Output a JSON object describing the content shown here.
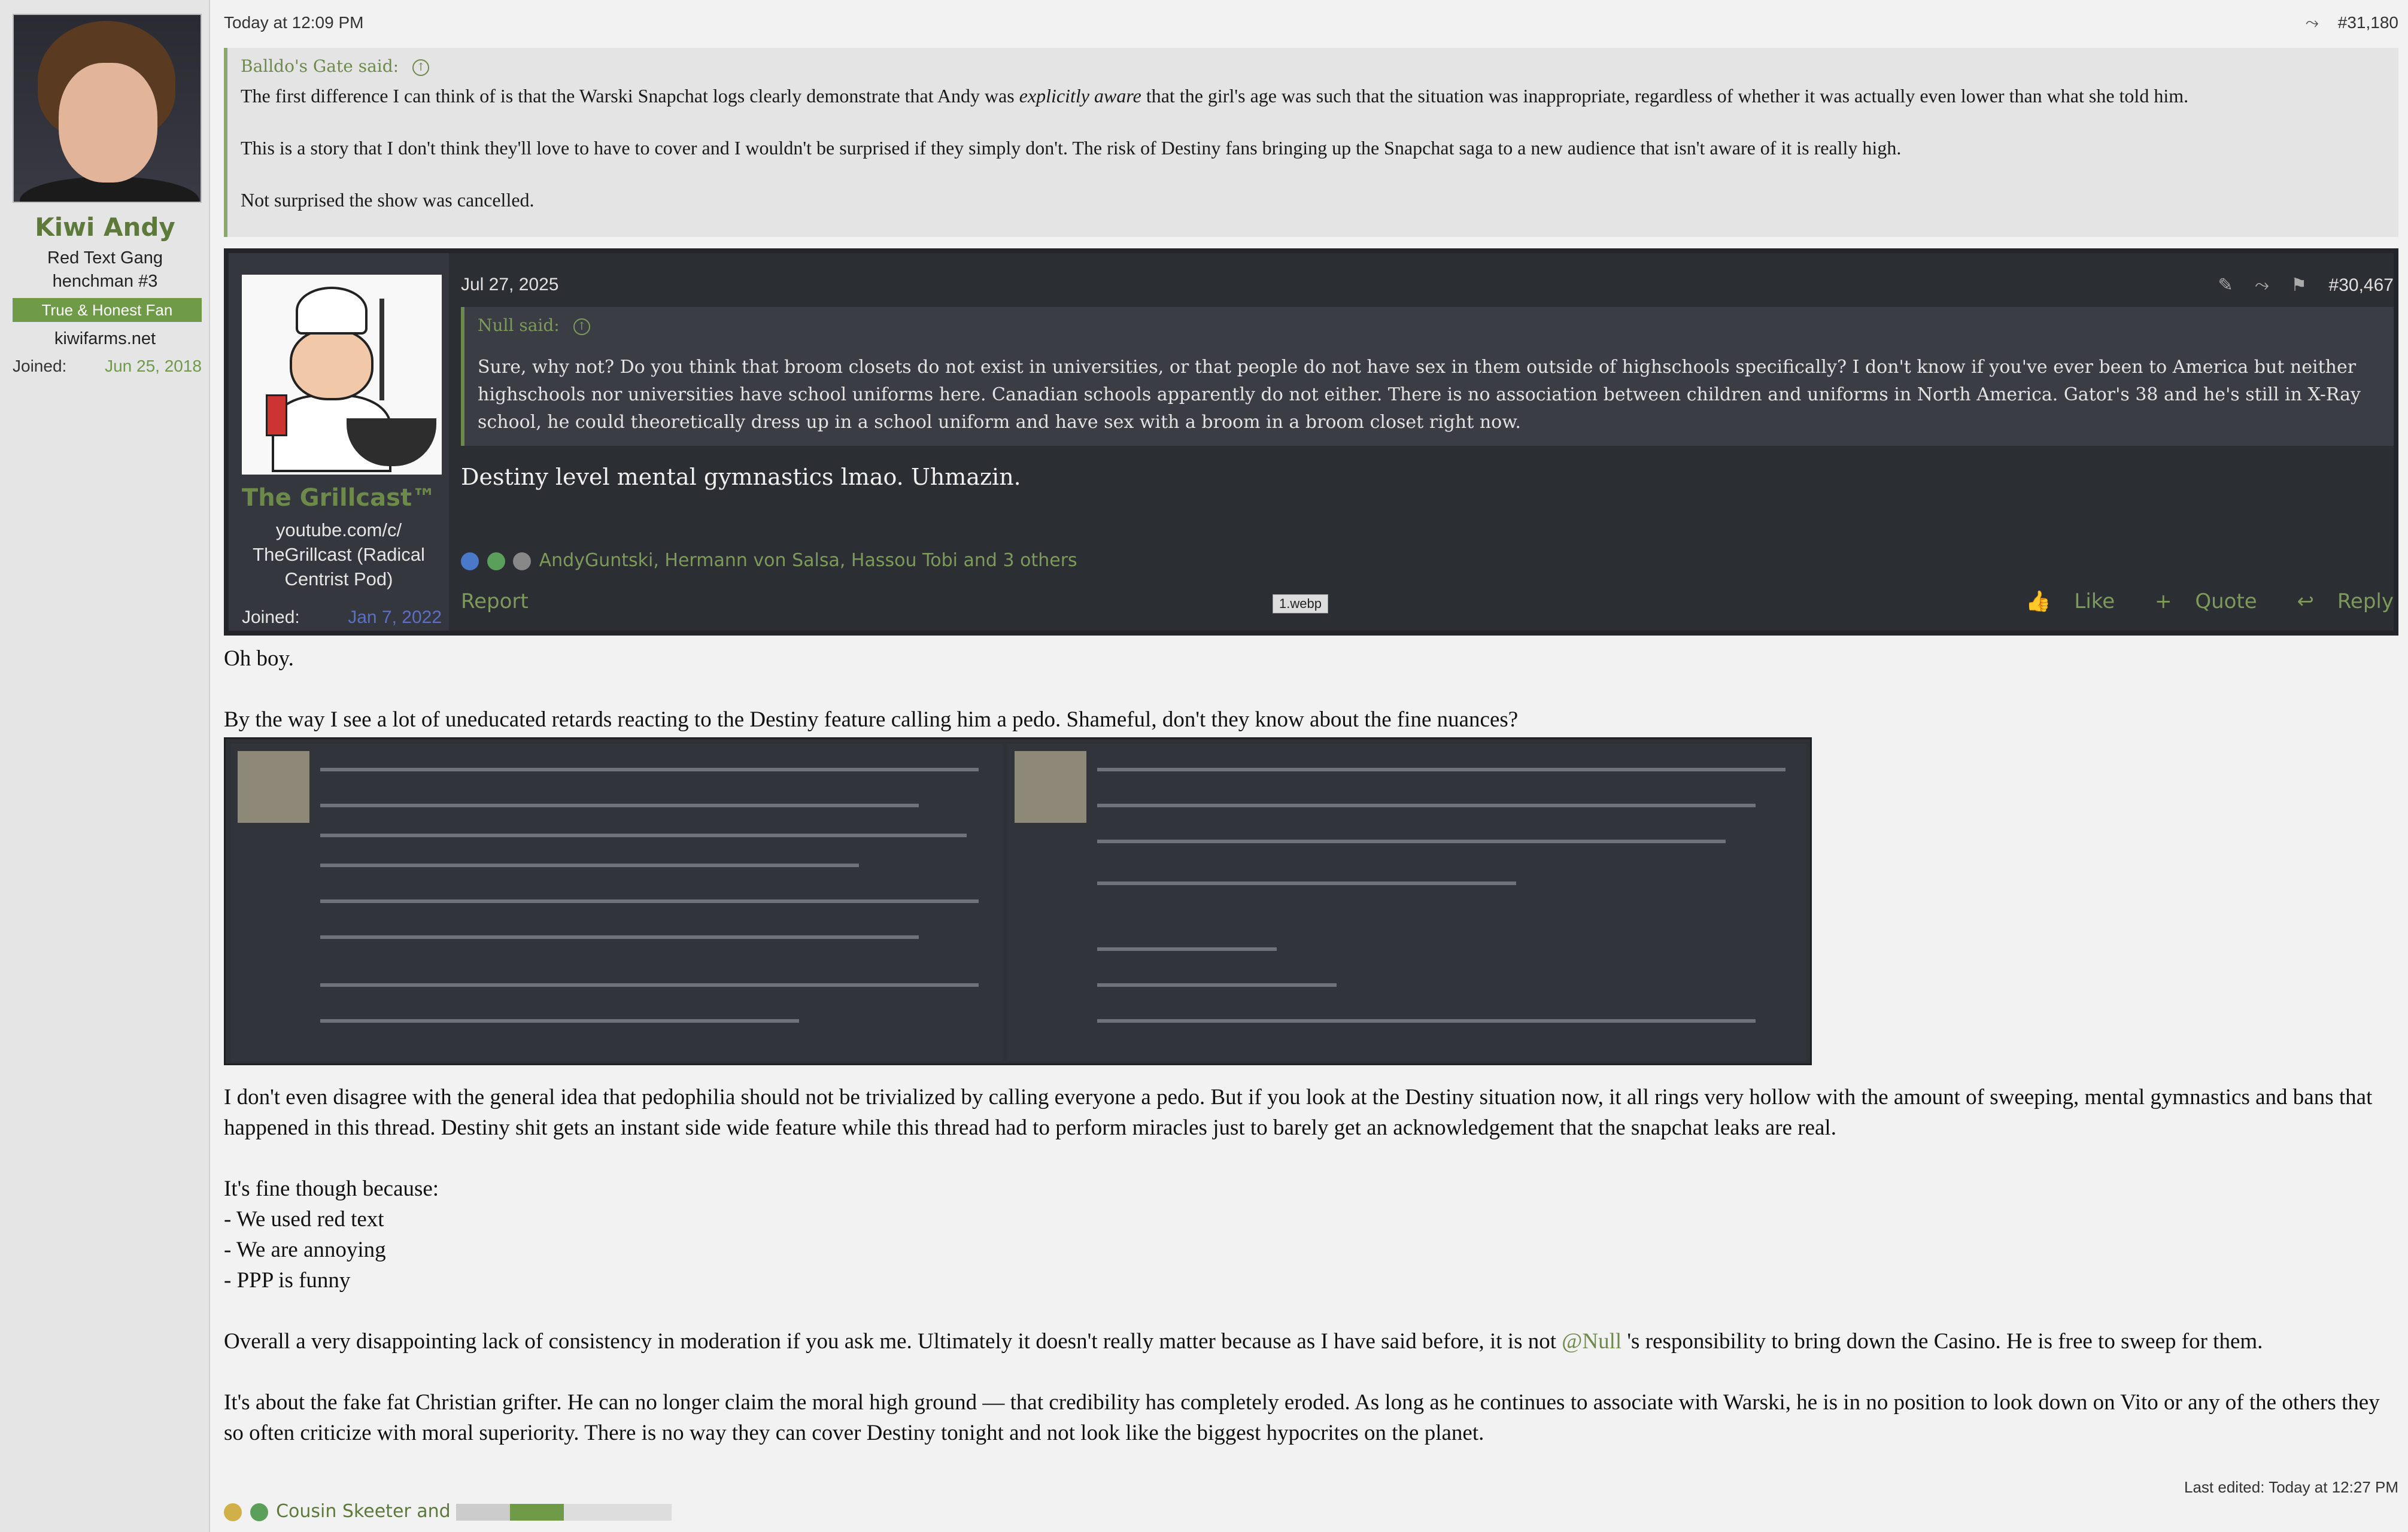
{
  "user": {
    "name": "Kiwi Andy",
    "title_line1": "Red Text Gang",
    "title_line2": "henchman #3",
    "banner": "True & Honest Fan",
    "site": "kiwifarms.net",
    "joined_label": "Joined:",
    "joined_value": "Jun 25, 2018"
  },
  "post": {
    "date": "Today at 12:09 PM",
    "number": "#31,180",
    "quote": {
      "author": "Balldo's Gate said:",
      "para1_pre": "The first difference I can think of is that the Warski Snapchat logs clearly demonstrate that Andy was ",
      "para1_em": "explicitly aware",
      "para1_post": " that the girl's age was such that the situation was inappropriate, regardless of whether it was actually even lower than what she told him.",
      "para2": "This is a story that I don't think they'll love to have to cover and I wouldn't be surprised if they simply don't. The risk of Destiny fans bringing up the Snapchat saga to a new audience that isn't aware of it is really high.",
      "para3": "Not surprised the show was cancelled."
    },
    "embed": {
      "user_name": "The Grillcast™",
      "user_title_l1": "youtube.com/c/",
      "user_title_l2": "TheGrillcast (Radical",
      "user_title_l3": "Centrist Pod)",
      "joined_label": "Joined:",
      "joined_value": "Jan 7, 2022",
      "date": "Jul 27, 2025",
      "number": "#30,467",
      "quote_author": "Null said:",
      "quote_text": "Sure, why not? Do you think that broom closets do not exist in universities, or that people do not have sex in them outside of highschools specifically? I don't know if you've ever been to America but neither highschools nor universities have school uniforms here. Canadian schools apparently do not either. There is no association between children and uniforms in North America. Gator's 38 and he's still in X-Ray school, he could theoretically dress up in a school uniform and have sex with a broom in a broom closet right now.",
      "body": "Destiny level mental gymnastics lmao. Uhmazin.",
      "reactions": "AndyGuntski, Hermann von Salsa, Hassou Tobi and 3 others",
      "report": "Report",
      "tooltip": "1.webp",
      "like": "Like",
      "quote_btn": "Quote",
      "reply": "Reply"
    },
    "p_oh_boy": "Oh boy.",
    "p_by_the_way": "By the way I see a lot of uneducated retards reacting to the Destiny feature calling him a pedo. Shameful, don't they know about the fine nuances?",
    "p_disagree": "I don't even disagree with the general idea that pedophilia should not be trivialized by calling everyone a pedo. But if you look at the Destiny situation now, it all rings very hollow with the amount of sweeping, mental gymnastics and bans that happened in this thread. Destiny shit gets an instant side wide feature while this thread had to perform miracles just to barely get an acknowledgement that the snapchat leaks are real.",
    "p_fine": "It's fine though because:",
    "list": [
      "- We used red text",
      "- We are annoying",
      "- PPP is funny"
    ],
    "p_overall_pre": "Overall a very disappointing lack of consistency in moderation if you ask me. Ultimately it doesn't really matter because as I have said before, it is not ",
    "p_overall_mention": "@Null",
    "p_overall_post": " 's responsibility to bring down the Casino. He is free to sweep for them.",
    "p_grifter": "It's about the fake fat Christian grifter. He can no longer claim the moral high ground — that credibility has completely eroded. As long as he continues to associate with Warski, he is in no position to look down on Vito or any of the others they so often criticize with moral superiority. There is no way they can cover Destiny tonight and not look like the biggest hypocrites on the planet.",
    "last_edited": "Last edited: Today at 12:27 PM",
    "reactions": "Cousin Skeeter and"
  }
}
